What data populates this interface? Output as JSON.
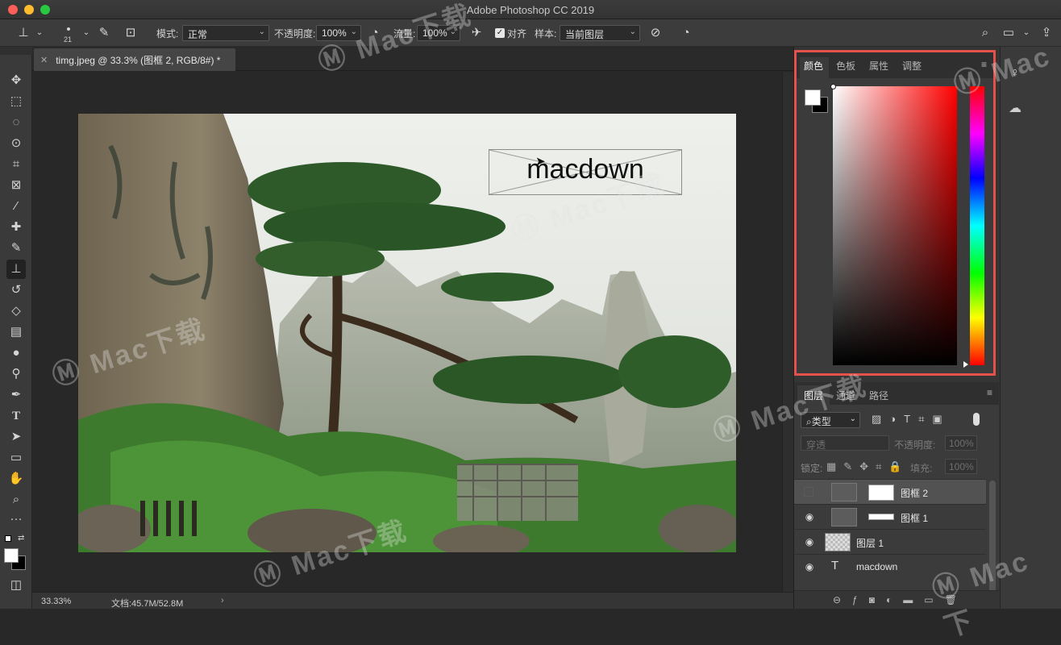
{
  "app": {
    "title": "Adobe Photoshop CC 2019"
  },
  "options_bar": {
    "brush_size": "21",
    "mode_label": "模式:",
    "mode_value": "正常",
    "opacity_label": "不透明度:",
    "opacity_value": "100%",
    "flow_label": "流量:",
    "flow_value": "100%",
    "aligned_label": "对齐",
    "aligned_checked": true,
    "sample_label": "样本:",
    "sample_value": "当前图层"
  },
  "document": {
    "tab_title": "timg.jpeg @ 33.3% (图框 2, RGB/8#) *",
    "frame_text": "macdown"
  },
  "status": {
    "zoom": "33.33%",
    "doc_size": "文档:45.7M/52.8M"
  },
  "color_panel": {
    "tabs": [
      "颜色",
      "色板",
      "属性",
      "调整"
    ],
    "active_tab": "颜色",
    "foreground": "#ffffff",
    "background": "#000000",
    "hue": "#ff0000"
  },
  "layers_panel": {
    "tabs": [
      "图层",
      "通道",
      "路径"
    ],
    "filter_label": "类型",
    "blend_mode": "穿透",
    "opacity_label": "不透明度:",
    "opacity_value": "100%",
    "lock_label": "锁定:",
    "fill_label": "填充:",
    "fill_value": "100%",
    "layers": [
      {
        "name": "图框 2",
        "visible": false,
        "selected": true,
        "kind": "frame"
      },
      {
        "name": "图框 1",
        "visible": true,
        "selected": false,
        "kind": "frame"
      },
      {
        "name": "图层 1",
        "visible": true,
        "selected": false,
        "kind": "raster"
      },
      {
        "name": "macdown",
        "visible": true,
        "selected": false,
        "kind": "text"
      }
    ]
  },
  "tools": [
    "move-tool",
    "marquee-tool",
    "lasso-tool",
    "quick-select-tool",
    "crop-tool",
    "frame-tool",
    "eyedropper-tool",
    "healing-tool",
    "brush-tool",
    "clone-stamp-tool",
    "history-brush-tool",
    "eraser-tool",
    "gradient-tool",
    "blur-tool",
    "dodge-tool",
    "pen-tool",
    "type-tool",
    "path-select-tool",
    "rectangle-tool",
    "hand-tool",
    "zoom-tool",
    "more-tools"
  ],
  "watermark": {
    "brand": "Mac下载",
    "site": "www.Macdown.com"
  }
}
